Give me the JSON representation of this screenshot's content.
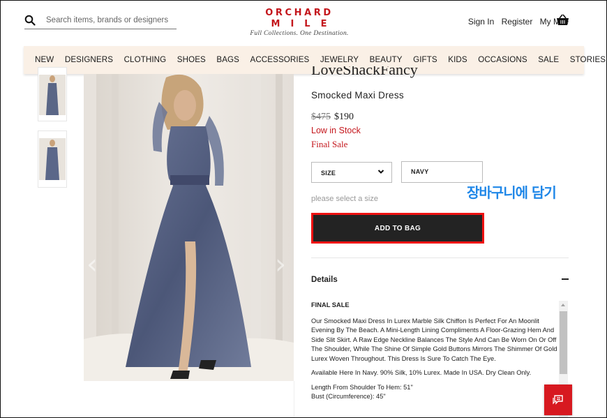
{
  "header": {
    "search_placeholder": "Search items, brands or designers",
    "logo_line1": "ORCHARD",
    "logo_line2": "MILE",
    "tagline": "Full Collections. One Destination.",
    "sign_in": "Sign In",
    "register": "Register",
    "my_mile": "My Mile"
  },
  "nav": {
    "items": [
      "NEW",
      "DESIGNERS",
      "CLOTHING",
      "SHOES",
      "BAGS",
      "ACCESSORIES",
      "JEWELRY",
      "BEAUTY",
      "GIFTS",
      "KIDS",
      "OCCASIONS",
      "SALE",
      "STORIES"
    ]
  },
  "product": {
    "brand": "LoveShackFancy",
    "name": "Smocked Maxi Dress",
    "price_original": "$475",
    "price_sale": "$190",
    "stock_status": "Low in Stock",
    "final_sale": "Final Sale",
    "size_label": "SIZE",
    "color_label": "NAVY",
    "size_hint": "please select a size",
    "add_to_bag": "ADD TO BAG",
    "annotation": "장바구니에 담기"
  },
  "details": {
    "heading": "Details",
    "final_sale_label": "FINAL SALE",
    "description": "Our Smocked Maxi Dress In Lurex Marble Silk Chiffon Is Perfect For An Moonlit Evening By The Beach. A Mini-Length Lining Compliments A Floor-Grazing Hem And Side Slit Skirt. A Raw Edge Neckline Balances The Style And Can Be Worn On Or Off The Shoulder, While The Shine Of Simple Gold Buttons Mirrors The Shimmer Of Gold Lurex Woven Throughout. This Dress Is Sure To Catch The Eye.",
    "availability": "Available Here In Navy. 90% Silk, 10% Lurex. Made In USA. Dry Clean Only.",
    "length": "Length From Shoulder To Hem: 51\"",
    "bust": "Bust (Circumference): 45\""
  },
  "colors": {
    "brand_red": "#c4161c",
    "nav_bg": "#faf0e6",
    "button_dark": "#232323",
    "annotation_blue": "#1f87e8",
    "highlight_red": "#ee1111"
  }
}
